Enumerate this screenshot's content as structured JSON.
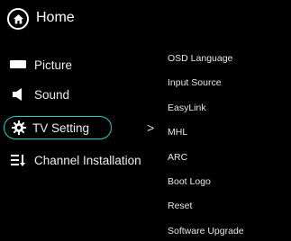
{
  "header": {
    "title": "Home",
    "icon": "home-icon"
  },
  "menu": {
    "items": [
      {
        "label": "Picture",
        "icon": "picture-icon"
      },
      {
        "label": "Sound",
        "icon": "speaker-icon"
      },
      {
        "label": "TV Setting",
        "icon": "gear-icon",
        "selected": true
      },
      {
        "label": "Channel Installation",
        "icon": "channel-list-icon"
      }
    ],
    "chevron": ">",
    "highlight_color": "#1fd1c6"
  },
  "submenu": {
    "items": [
      "OSD Language",
      "Input Source",
      "EasyLink",
      "MHL",
      "ARC",
      "Boot Logo",
      "Reset",
      "Software Upgrade"
    ]
  }
}
